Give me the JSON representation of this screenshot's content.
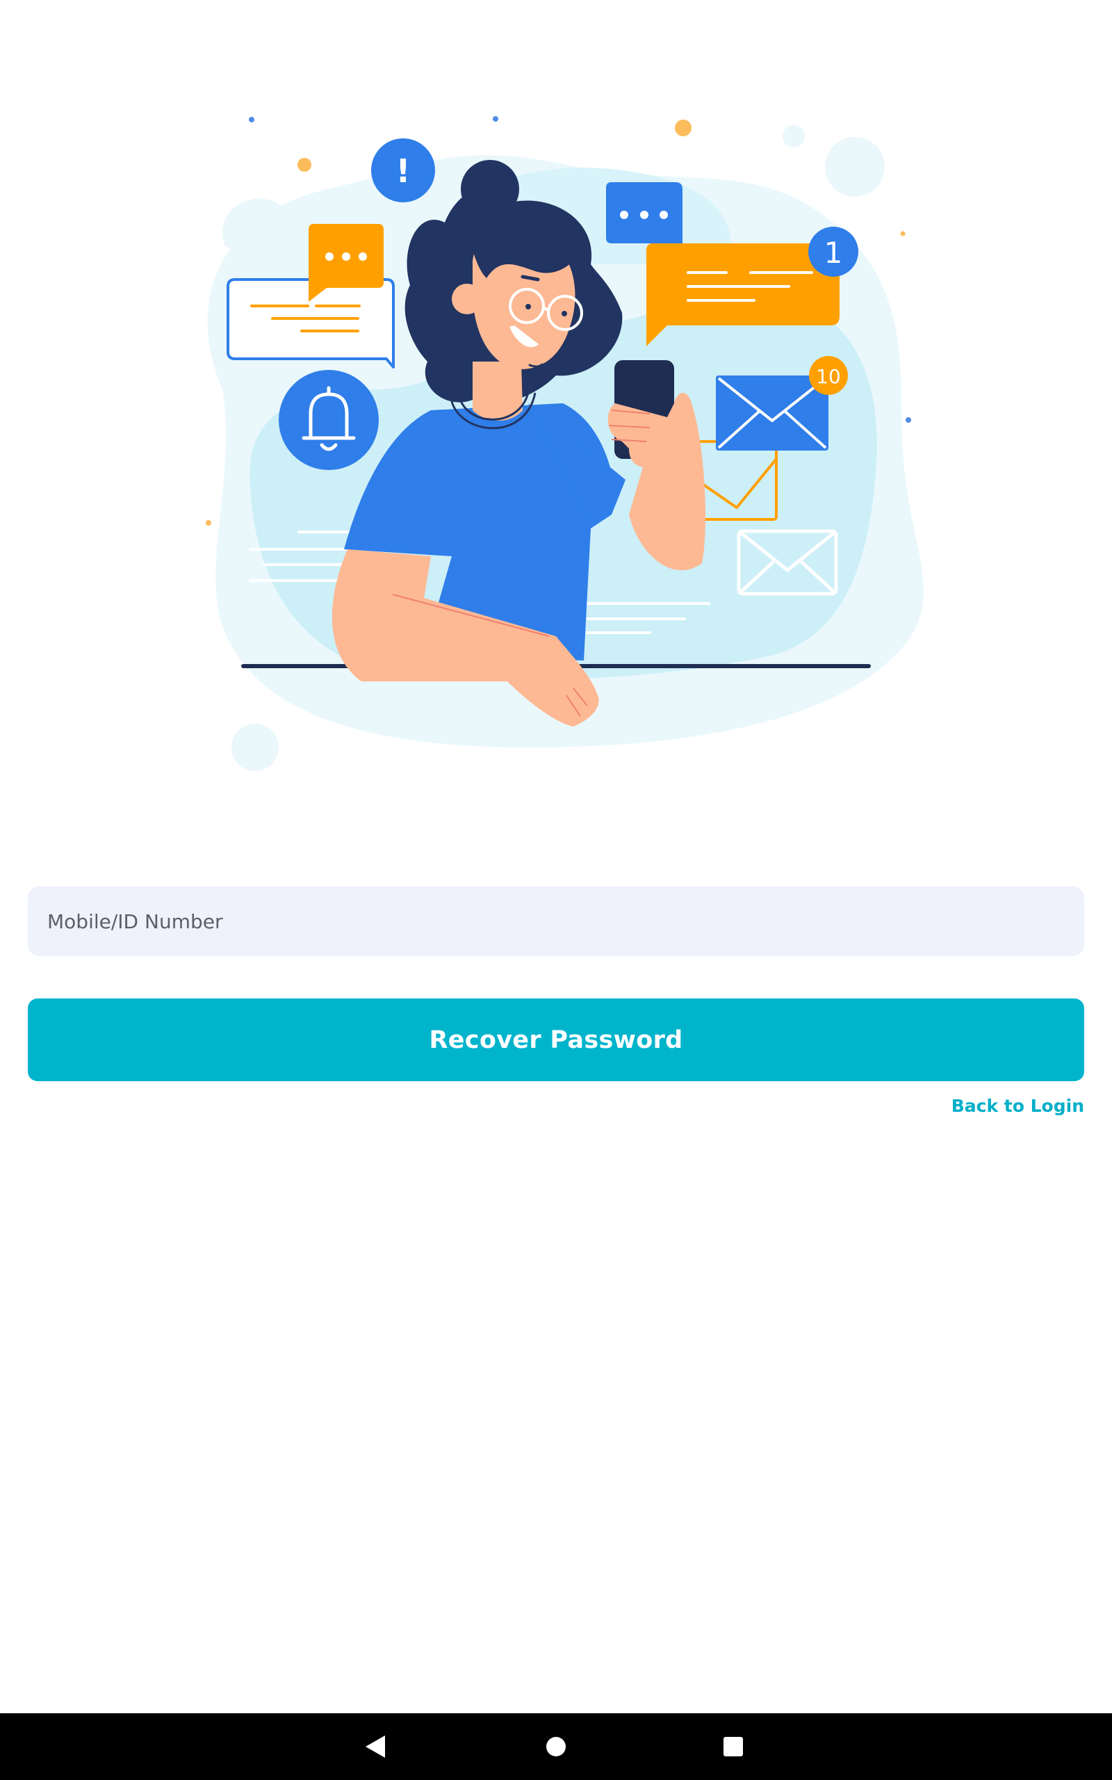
{
  "illustration": {
    "alert_badge": "!",
    "chat_badge_count": "1",
    "mail_badge_count": "10"
  },
  "form": {
    "mobile_placeholder": "Mobile/ID Number",
    "mobile_value": "",
    "recover_label": "Recover Password",
    "back_label": "Back to Login"
  },
  "navigation_bar": {
    "back_icon": "triangle-back-icon",
    "home_icon": "circle-home-icon",
    "recents_icon": "square-recents-icon"
  },
  "colors": {
    "accent": "#00b4cc",
    "input_background": "#eff2fd",
    "illustration_blue": "#2f7ee9",
    "illustration_orange": "#ffa000",
    "illustration_navy": "#23345f"
  }
}
